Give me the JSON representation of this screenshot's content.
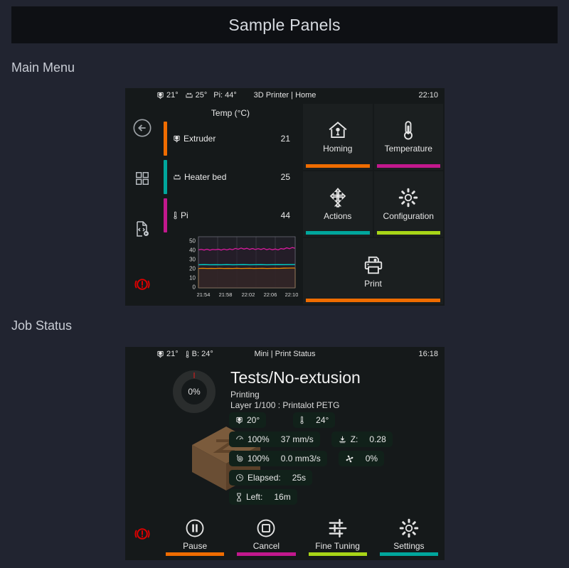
{
  "header": {
    "title": "Sample Panels"
  },
  "sections": {
    "main_menu_label": "Main Menu",
    "job_status_label": "Job Status"
  },
  "main_panel": {
    "statusbar": {
      "extruder_temp": "21°",
      "bed_temp": "25°",
      "pi_temp": "Pi: 44°",
      "title": "3D Printer | Home",
      "clock": "22:10"
    },
    "rail": [
      {
        "name": "back-icon",
        "label": "Back"
      },
      {
        "name": "grid-icon",
        "label": "Menu"
      },
      {
        "name": "macro-icon",
        "label": "Macros"
      },
      {
        "name": "emergency-stop-icon",
        "label": "Emergency Stop"
      }
    ],
    "temp_panel": {
      "heading": "Temp (°C)",
      "rows": [
        {
          "name": "Extruder",
          "value": "21",
          "color": "#ef6c00",
          "icon": "extruder-icon"
        },
        {
          "name": "Heater bed",
          "value": "25",
          "color": "#00a69c",
          "icon": "heater-bed-icon"
        },
        {
          "name": "Pi",
          "value": "44",
          "color": "#c2188d",
          "icon": "thermometer-icon"
        }
      ]
    },
    "menu_buttons": [
      {
        "label": "Homing",
        "color": "#ef6c00",
        "icon": "home-icon"
      },
      {
        "label": "Temperature",
        "color": "#c2188d",
        "icon": "thermometer-icon"
      },
      {
        "label": "Actions",
        "color": "#00a69c",
        "icon": "move-arrows-icon"
      },
      {
        "label": "Configuration",
        "color": "#a8d517",
        "icon": "gear-icon"
      },
      {
        "label": "Print",
        "color": "#ef6c00",
        "icon": "printer-icon"
      }
    ]
  },
  "job_panel": {
    "statusbar": {
      "extruder_temp": "21°",
      "bed_temp": "B: 24°",
      "title": "Mini | Print Status",
      "clock": "16:18"
    },
    "progress": "0%",
    "file_title": "Tests/No-extusion",
    "state": "Printing",
    "layer_info": "Layer 1/100 : Printalot PETG",
    "stats": [
      [
        {
          "icon": "extruder-icon",
          "text": "20°"
        },
        {
          "icon": "thermometer-icon",
          "text": "24°"
        }
      ],
      [
        {
          "icon": "speed-icon",
          "text": "100%",
          "text2": "37 mm/s"
        },
        {
          "icon": "z-offset-icon",
          "text": "Z:",
          "text2": "0.28"
        }
      ],
      [
        {
          "icon": "flow-icon",
          "text": "100%",
          "text2": "0.0 mm3/s"
        },
        {
          "icon": "fan-icon",
          "text": "0%"
        }
      ],
      [
        {
          "icon": "clock-icon",
          "text": "Elapsed:",
          "text2": "25s"
        }
      ],
      [
        {
          "icon": "hourglass-icon",
          "text": "Left:",
          "text2": "16m"
        }
      ]
    ],
    "actions": [
      {
        "label": "Pause",
        "color": "#ef6c00",
        "icon": "pause-icon"
      },
      {
        "label": "Cancel",
        "color": "#c2188d",
        "icon": "stop-icon"
      },
      {
        "label": "Fine Tuning",
        "color": "#a8d517",
        "icon": "sliders-icon"
      },
      {
        "label": "Settings",
        "color": "#00a69c",
        "icon": "gear-icon"
      }
    ],
    "emergency_stop": "emergency-stop-icon"
  },
  "chart_data": {
    "type": "line",
    "title": "Temp (°C)",
    "xlabel": "",
    "ylabel": "",
    "ylim": [
      0,
      55
    ],
    "yticks": [
      0,
      10,
      20,
      30,
      40,
      50
    ],
    "xticks": [
      "21:54",
      "21:58",
      "22:02",
      "22:06",
      "22:10"
    ],
    "grid": true,
    "series": [
      {
        "name": "Pi",
        "color": "#c2188d",
        "mean": 42,
        "values": [
          41,
          41.5,
          41,
          42,
          41,
          41.5,
          41,
          40.5,
          41,
          42,
          41.5,
          41,
          42,
          43,
          41.5,
          42,
          43,
          42.5,
          42,
          41.5,
          42,
          43,
          42,
          41.5,
          41,
          42,
          42.5,
          43,
          42,
          43,
          44,
          43
        ]
      },
      {
        "name": "Heater bed",
        "color": "#00d0c8",
        "mean": 25,
        "values": [
          25,
          25,
          25,
          25,
          25,
          25,
          25,
          25,
          25,
          25,
          25,
          25,
          25,
          25,
          25,
          25,
          25,
          25,
          25,
          25,
          25,
          25,
          25,
          25,
          25,
          25,
          25,
          25,
          25,
          25,
          25,
          25
        ]
      },
      {
        "name": "Extruder",
        "color": "#ef8c00",
        "mean": 21,
        "values": [
          21,
          21,
          21,
          21,
          21,
          21,
          21,
          21,
          21,
          21,
          21,
          21,
          21,
          21,
          21,
          21,
          21,
          21,
          21,
          21,
          21,
          21,
          21,
          21,
          21,
          21,
          21,
          21,
          21,
          21,
          21.5,
          21.5
        ]
      }
    ]
  }
}
